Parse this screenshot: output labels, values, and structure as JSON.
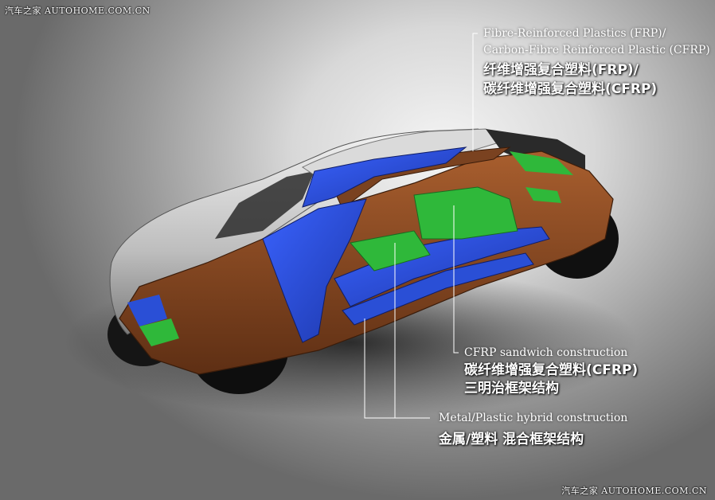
{
  "watermark_top": {
    "cn": "汽车之家",
    "en": "AUTOHOME.COM.CN"
  },
  "watermark_bottom": {
    "cn": "汽车之家",
    "en": "AUTOHOME.COM.CN"
  },
  "labels": {
    "frp": {
      "en_line1": "Fibre-Reinforced Plastics (FRP)/",
      "en_line2": "Carbon-Fibre Reinforced Plastic (CFRP)",
      "zh_line1": "纤维增强复合塑料(FRP)/",
      "zh_line2": "碳纤维增强复合塑料(CFRP)"
    },
    "sandwich": {
      "en": "CFRP sandwich construction",
      "zh_line1": "碳纤维增强复合塑料(CFRP)",
      "zh_line2": "三明治框架结构"
    },
    "hybrid": {
      "en": "Metal/Plastic hybrid construction",
      "zh": "金属/塑料 混合框架结构"
    }
  },
  "colors": {
    "frp_brown": "#8a4a22",
    "cfrp_blue": "#2a4fd6",
    "sandwich_green": "#2fb83a",
    "body_silver": "#c8c8c8"
  }
}
